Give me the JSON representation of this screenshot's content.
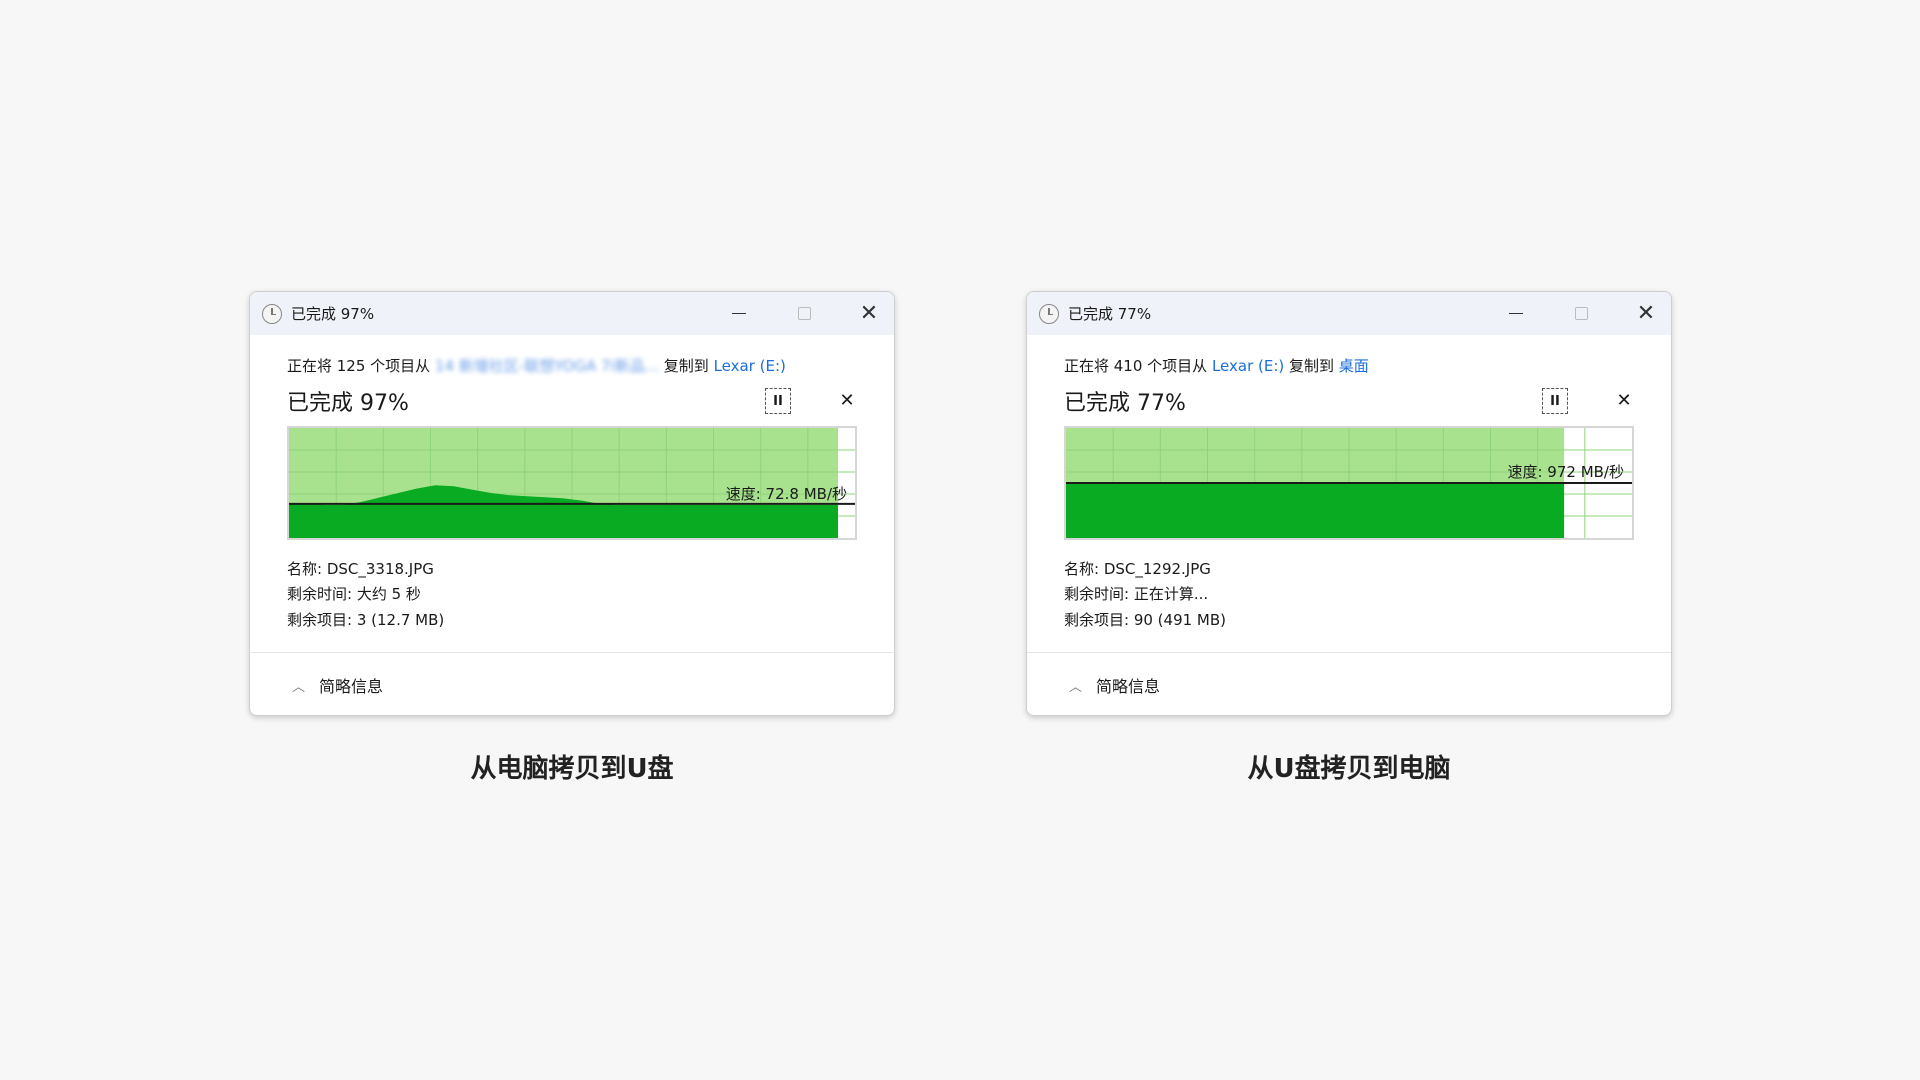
{
  "colors": {
    "fill": "#08ab22",
    "light": "#a8e28f",
    "grid": "#8fd47a",
    "link": "#1a6fdc"
  },
  "dialogs": [
    {
      "title": "已完成 97%",
      "line": {
        "prefix": "正在将 125 个项目从 ",
        "source": "14 新增社区-联想YOGA 7i新品...",
        "mid": " 复制到 ",
        "dest": "Lexar (E:)"
      },
      "percent_label": "已完成 97%",
      "progress": 97,
      "speed": "速度: 72.8 MB/秒",
      "speed_level": 0.31,
      "speed_history": [
        0.31,
        0.31,
        0.3,
        0.3,
        0.33,
        0.37,
        0.41,
        0.45,
        0.48,
        0.47,
        0.44,
        0.41,
        0.39,
        0.38,
        0.37,
        0.36,
        0.34,
        0.31,
        0.3,
        0.3,
        0.3,
        0.3,
        0.3,
        0.3,
        0.3,
        0.3,
        0.3,
        0.3,
        0.3,
        0.3,
        0.3
      ],
      "name": "名称: DSC_3318.JPG",
      "time": "剩余时间: 大约 5 秒",
      "items": "剩余项目: 3 (12.7 MB)",
      "footer": "简略信息",
      "caption": "从电脑拷贝到U盘"
    },
    {
      "title": "已完成 77%",
      "line": {
        "prefix": "正在将 410 个项目从 ",
        "source": "Lexar (E:)",
        "mid": " 复制到 ",
        "dest": "桌面"
      },
      "percent_label": "已完成 77%",
      "progress": 88,
      "speed": "速度: 972 MB/秒",
      "speed_level": 0.5,
      "speed_history": [
        0.5,
        0.5,
        0.5,
        0.5,
        0.5,
        0.5,
        0.5,
        0.5,
        0.5,
        0.5,
        0.5,
        0.5,
        0.5,
        0.5,
        0.5,
        0.5,
        0.5,
        0.5,
        0.5,
        0.5,
        0.5,
        0.5,
        0.5,
        0.5,
        0.5
      ],
      "name": "名称: DSC_1292.JPG",
      "time": "剩余时间: 正在计算...",
      "items": "剩余项目: 90 (491 MB)",
      "footer": "简略信息",
      "caption": "从U盘拷贝到电脑"
    }
  ]
}
